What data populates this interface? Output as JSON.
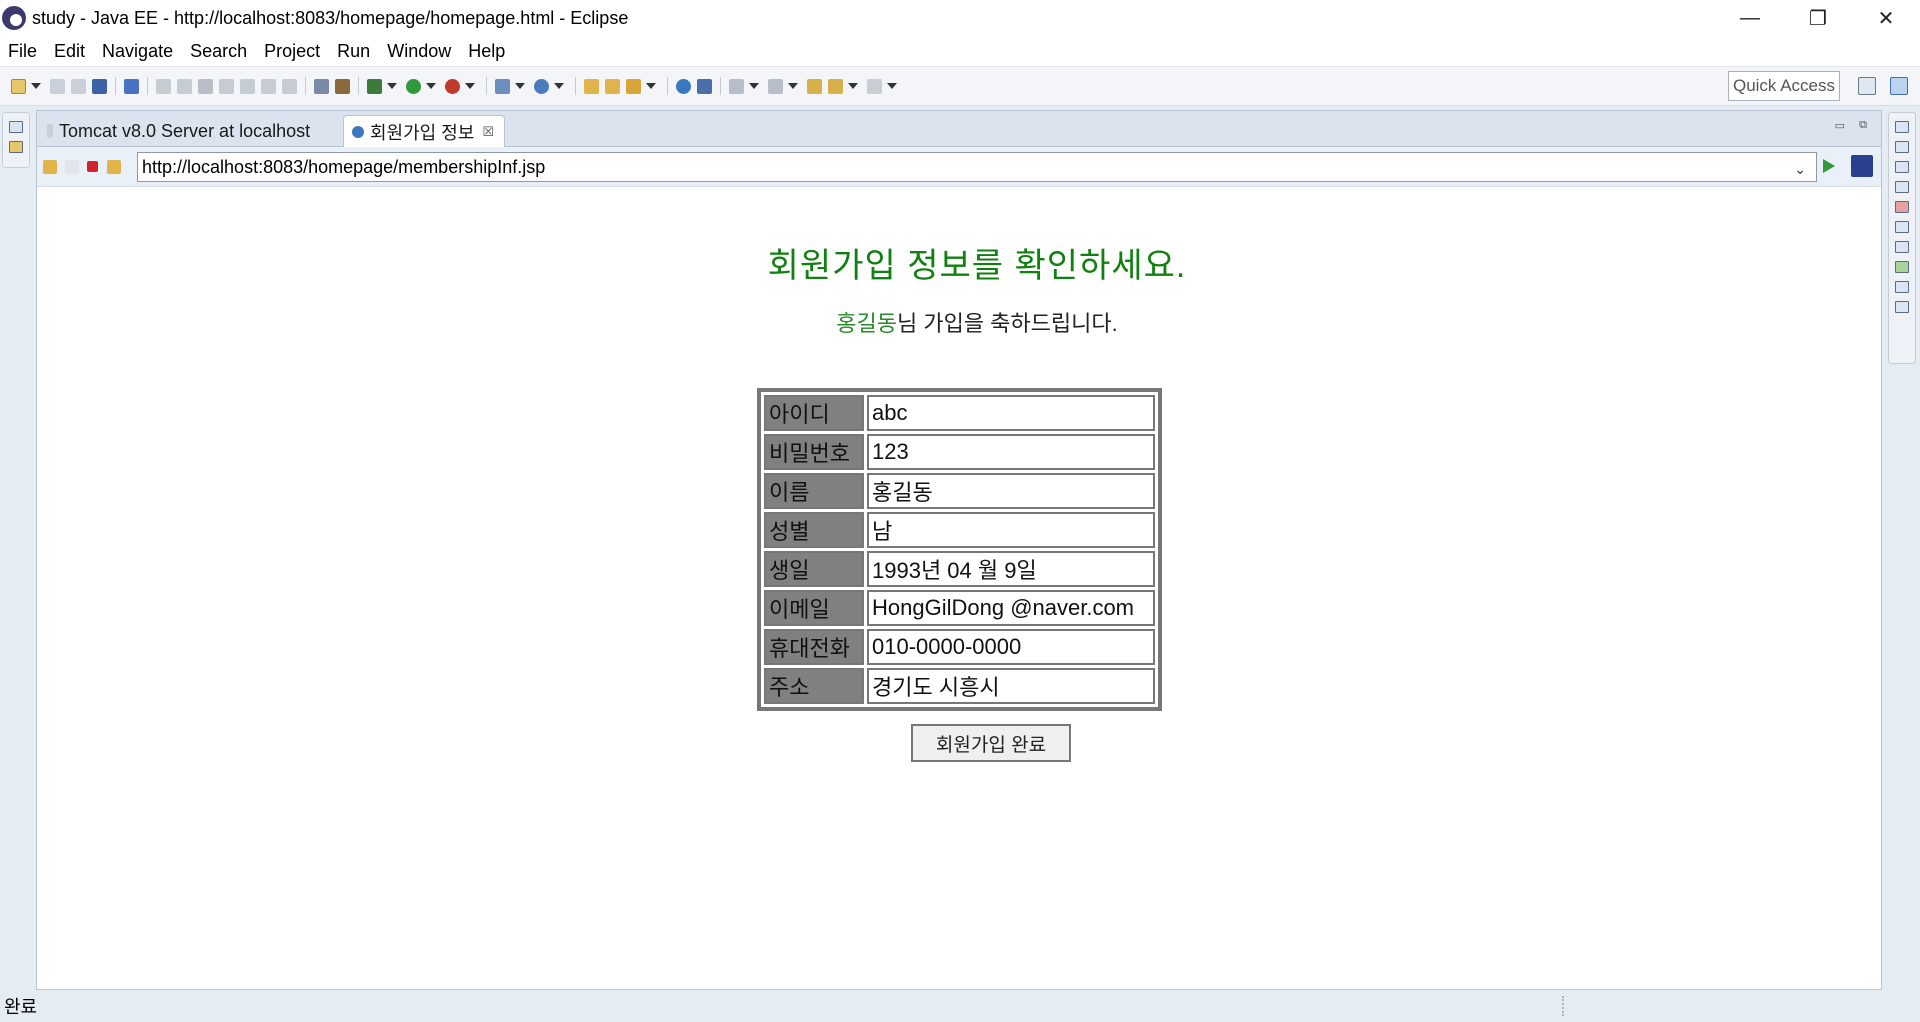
{
  "window": {
    "title": "study - Java EE - http://localhost:8083/homepage/homepage.html - Eclipse",
    "minimize_icon": "minimize-icon",
    "maximize_icon": "restore-icon",
    "close_icon": "close-icon",
    "minimize_glyph": "—",
    "restore_glyph": "❐",
    "close_glyph": "✕"
  },
  "menu": [
    "File",
    "Edit",
    "Navigate",
    "Search",
    "Project",
    "Run",
    "Window",
    "Help"
  ],
  "toolbar": {
    "quick_access": "Quick Access"
  },
  "tabs": [
    {
      "label": "Tomcat v8.0 Server at localhost",
      "active": false
    },
    {
      "label": "회원가입 정보",
      "active": true,
      "close": "☒"
    }
  ],
  "browser": {
    "url": "http://localhost:8083/homepage/membershipInf.jsp",
    "url_dropdown": "⌄"
  },
  "page": {
    "title": "회원가입 정보를 확인하세요.",
    "welcome_name": "홍길동",
    "welcome_rest": "님 가입을 축하드립니다.",
    "rows": [
      {
        "label": "아이디",
        "value": "abc"
      },
      {
        "label": "비밀번호",
        "value": "123"
      },
      {
        "label": "이름",
        "value": "홍길동"
      },
      {
        "label": "성별",
        "value": "남"
      },
      {
        "label": "생일",
        "value": "1993년 04 월 9일"
      },
      {
        "label": "이메일",
        "value": "HongGilDong @naver.com"
      },
      {
        "label": "휴대전화",
        "value": "010-0000-0000"
      },
      {
        "label": "주소",
        "value": "경기도 시흥시"
      }
    ],
    "submit_label": "회원가입 완료"
  },
  "status": {
    "text": "완료"
  },
  "colors": {
    "title_green": "#108010",
    "name_green": "#2a8a2a",
    "label_cell": "#808080",
    "workbench_bg": "#e6ecf4"
  }
}
